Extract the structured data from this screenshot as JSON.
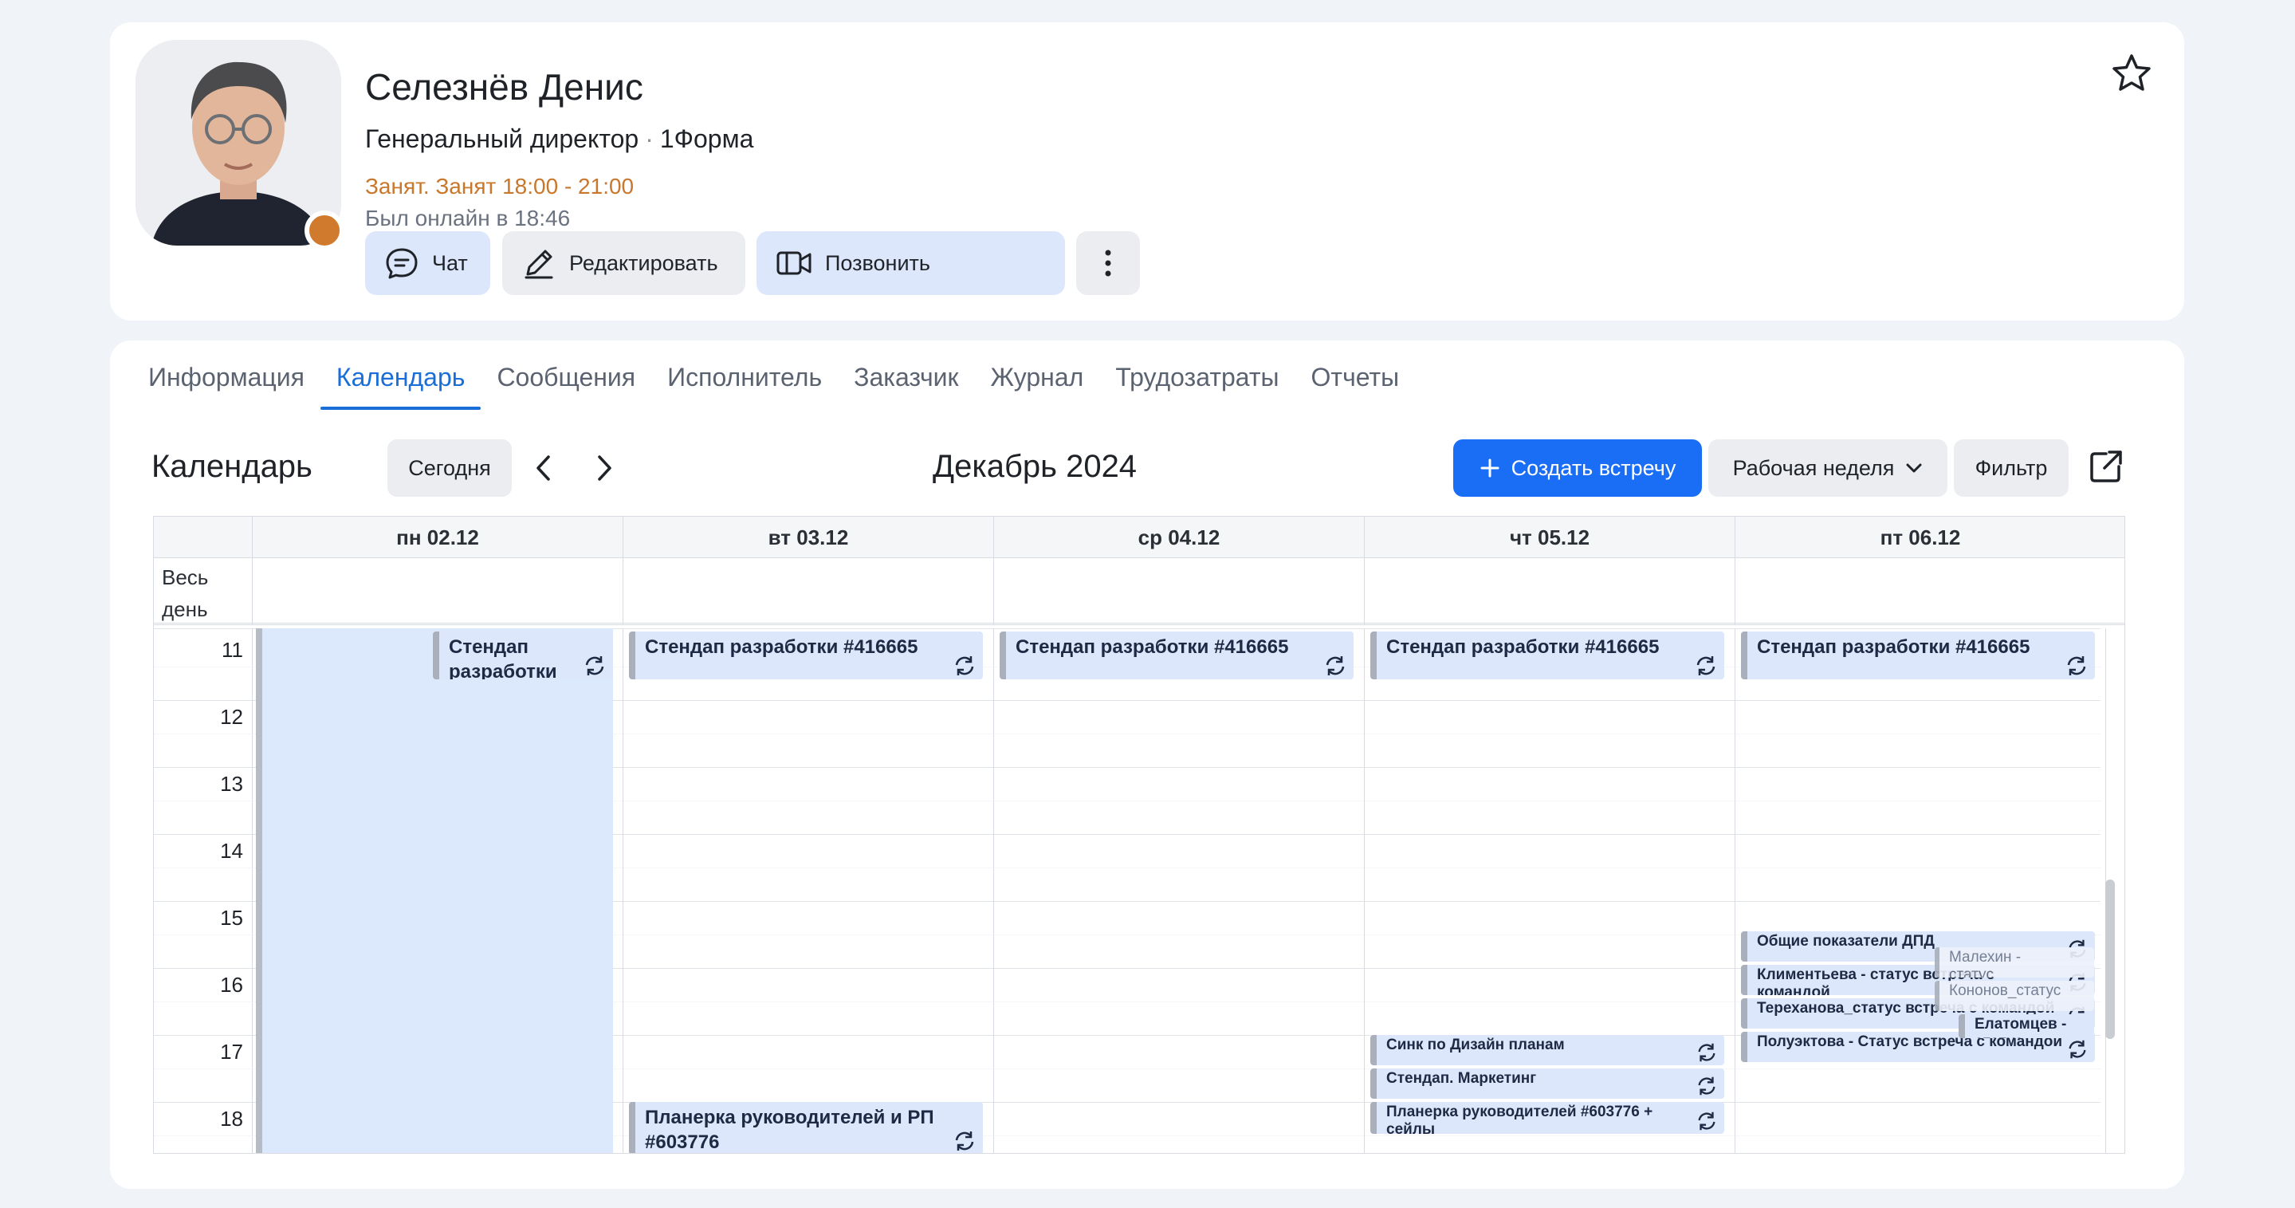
{
  "profile": {
    "name": "Селезнёв Денис",
    "position": "Генеральный директор",
    "company": "1Форма",
    "busy_status": "Занят. Занят  18:00 - 21:00",
    "last_seen": "Был онлайн в 18:46",
    "status_color": "#cf7a2c",
    "buttons": {
      "chat": "Чат",
      "edit": "Редактировать",
      "call": "Позвонить"
    }
  },
  "tabs": [
    {
      "label": "Информация",
      "active": false
    },
    {
      "label": "Календарь",
      "active": true
    },
    {
      "label": "Сообщения",
      "active": false
    },
    {
      "label": "Исполнитель",
      "active": false
    },
    {
      "label": "Заказчик",
      "active": false
    },
    {
      "label": "Журнал",
      "active": false
    },
    {
      "label": "Трудозатраты",
      "active": false
    },
    {
      "label": "Отчеты",
      "active": false
    }
  ],
  "calendar": {
    "title": "Календарь",
    "today": "Сегодня",
    "month": "Декабрь 2024",
    "create": "Создать встречу",
    "view": "Рабочая неделя",
    "filter": "Фильтр",
    "allday_label": "Весь день",
    "days": [
      "пн 02.12",
      "вт 03.12",
      "ср 04.12",
      "чт 05.12",
      "пт 06.12"
    ],
    "hours": [
      "11",
      "12",
      "13",
      "14",
      "15",
      "16",
      "17",
      "18"
    ],
    "events": {
      "mon_standup": "Стендап разработки",
      "tue_standup": "Стендап разработки #416665",
      "wed_standup": "Стендап разработки #416665",
      "thu_standup": "Стендап разработки #416665",
      "fri_standup": "Стендап разработки #416665",
      "tue_planning": "Планерка руководителей и РП #603776",
      "thu_sync": "Синк по Дизайн планам",
      "thu_marketing": "Стендап. Маркетинг",
      "thu_planning": "Планерка руководителей #603776 + сейлы",
      "fri_dpd": "Общие показатели ДПД",
      "fri_malekhin": "Малехин - статус",
      "fri_klimentyeva": "Климентьева - статус встреча с командой",
      "fri_kononov": "Кононов_статус",
      "fri_terekhanova": "Тереханова_статус встреча с командой",
      "fri_elatomtsev": "Елатомцев - статус",
      "fri_poluektova": "Полуэктова - Статус встреча с командой"
    }
  },
  "colors": {
    "accent": "#1a6ef5",
    "event_bg": "#dce7fb",
    "busy": "#c8772b"
  }
}
